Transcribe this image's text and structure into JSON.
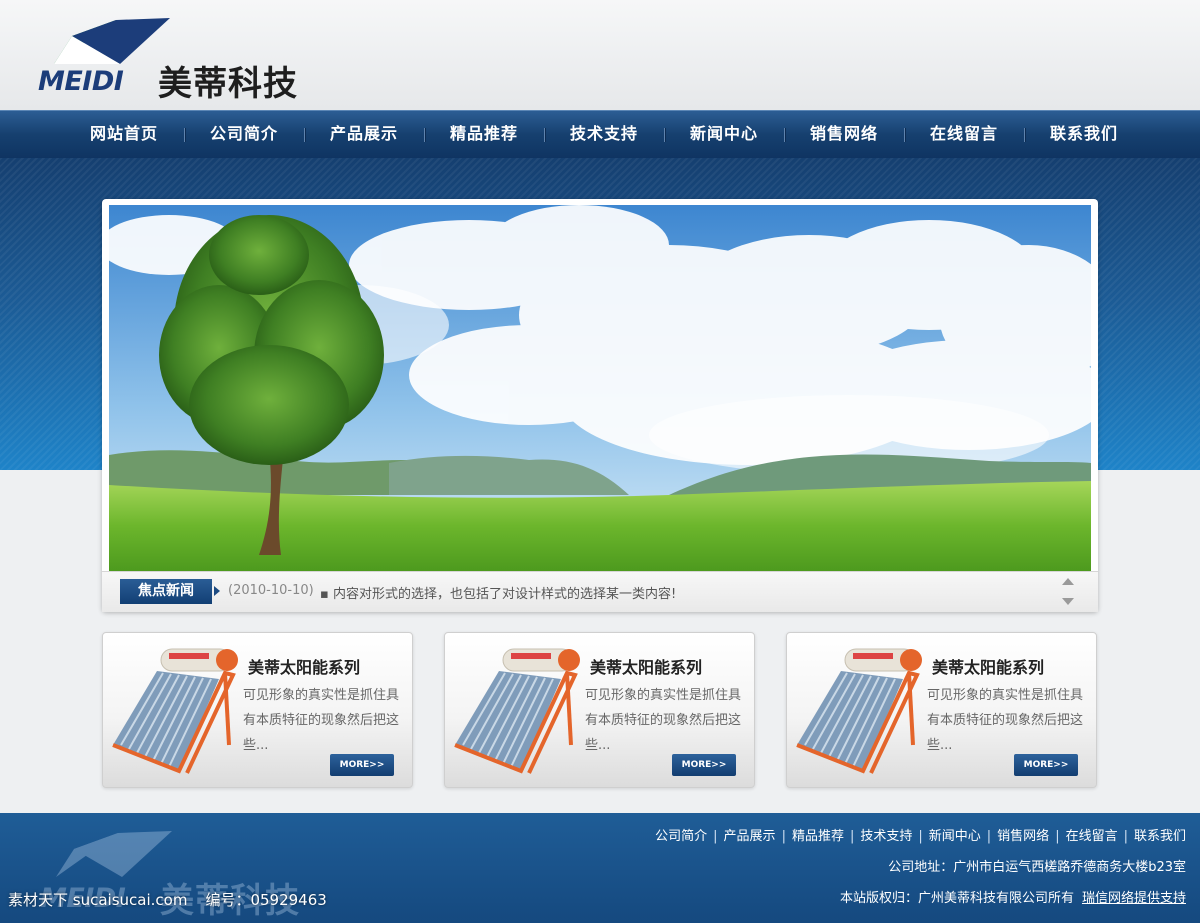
{
  "brand": {
    "en_name": "MEIDI",
    "cn_name": "美蒂科技",
    "colors": {
      "mark_green": "#1f8a43",
      "mark_blue": "#1c3d7a"
    }
  },
  "nav": {
    "items": [
      "网站首页",
      "公司简介",
      "产品展示",
      "精品推荐",
      "技术支持",
      "新闻中心",
      "销售网络",
      "在线留言",
      "联系我们"
    ]
  },
  "ticker": {
    "label": "焦点新闻",
    "date": "(2010-10-10)",
    "text": "▪ 内容对形式的选择，也包括了对设计样式的选择某一类内容!"
  },
  "products": [
    {
      "title": "美蒂太阳能系列",
      "desc": "可见形象的真实性是抓住具有本质特征的现象然后把这些...",
      "more": "MORE>>"
    },
    {
      "title": "美蒂太阳能系列",
      "desc": "可见形象的真实性是抓住具有本质特征的现象然后把这些...",
      "more": "MORE>>"
    },
    {
      "title": "美蒂太阳能系列",
      "desc": "可见形象的真实性是抓住具有本质特征的现象然后把这些...",
      "more": "MORE>>"
    }
  ],
  "footer": {
    "links": [
      "公司简介",
      "产品展示",
      "精品推荐",
      "技术支持",
      "新闻中心",
      "销售网络",
      "在线留言",
      "联系我们"
    ],
    "address": "公司地址：广州市白运气西槎路乔德商务大楼b23室",
    "copyright": "本站版权归：广州美蒂科技有限公司所有",
    "support": "瑞信网络提供支持"
  },
  "watermark": {
    "site": "素材天下 sucaisucai.com",
    "code": "编号：05929463"
  }
}
